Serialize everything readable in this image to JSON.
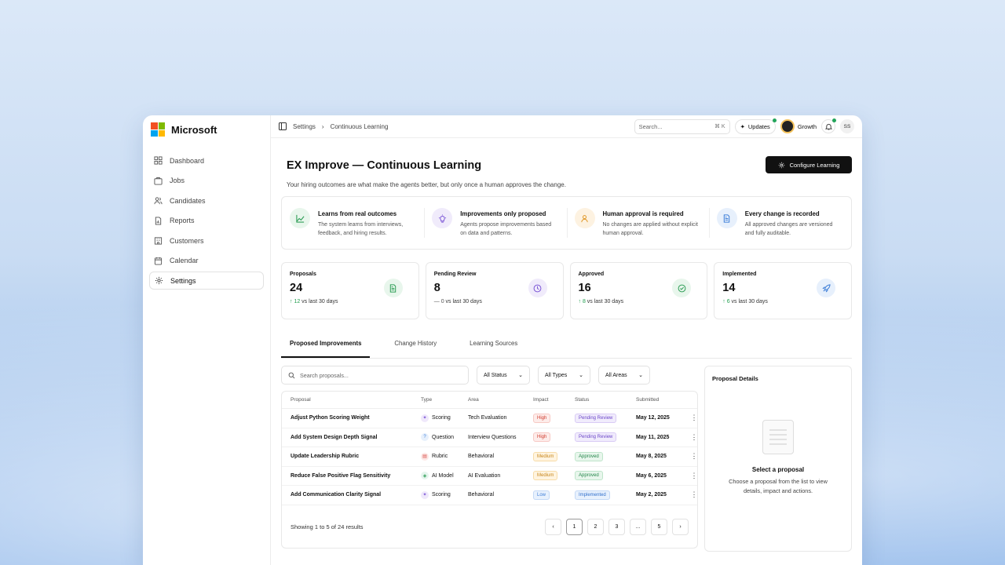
{
  "brand": {
    "name": "Microsoft",
    "logo_colors": [
      "#f25022",
      "#7fba00",
      "#00a4ef",
      "#ffb900"
    ]
  },
  "sidebar": {
    "items": [
      {
        "label": "Dashboard",
        "icon": "grid-icon"
      },
      {
        "label": "Jobs",
        "icon": "briefcase-icon"
      },
      {
        "label": "Candidates",
        "icon": "users-icon"
      },
      {
        "label": "Reports",
        "icon": "file-chart-icon"
      },
      {
        "label": "Customers",
        "icon": "building-icon"
      },
      {
        "label": "Calendar",
        "icon": "calendar-icon"
      },
      {
        "label": "Settings",
        "icon": "gear-icon",
        "active": true
      }
    ]
  },
  "topbar": {
    "breadcrumb": [
      "Settings",
      "Continuous Learning"
    ],
    "search_placeholder": "Search...",
    "search_shortcut": "⌘ K",
    "updates_label": "Updates",
    "workspace": "Growth",
    "user_initials": "SS"
  },
  "page": {
    "title": "EX Improve — Continuous Learning",
    "subtitle": "Your hiring outcomes are what make the agents better, but only once a human approves the change.",
    "configure_label": "Configure Learning"
  },
  "principles": [
    {
      "title": "Learns from real outcomes",
      "desc": "The system learns from interviews, feedback, and hiring results.",
      "icon": "trend-icon",
      "color": "#e8f6ec",
      "stroke": "#2f9e57"
    },
    {
      "title": "Improvements only proposed",
      "desc": "Agents propose improvements based on data and patterns.",
      "icon": "lightbulb-icon",
      "color": "#f0ebfb",
      "stroke": "#7c57d6"
    },
    {
      "title": "Human approval is required",
      "desc": "No changes are applied without explicit human approval.",
      "icon": "person-icon",
      "color": "#fdf2e1",
      "stroke": "#e19a2c"
    },
    {
      "title": "Every change is recorded",
      "desc": "All approved changes are versioned and fully auditable.",
      "icon": "document-icon",
      "color": "#e7f0fc",
      "stroke": "#3f7fd8"
    }
  ],
  "stats": [
    {
      "label": "Proposals",
      "value": "24",
      "arrow": "↑",
      "delta": "12",
      "suffix": "vs last 30 days",
      "icon": "document-icon",
      "bg": "#e8f6ec",
      "fg": "#2f9e57"
    },
    {
      "label": "Pending Review",
      "value": "8",
      "arrow": "—",
      "delta": "0",
      "suffix": "vs last 30 days",
      "icon": "clock-icon",
      "bg": "#f0ebfb",
      "fg": "#7c57d6"
    },
    {
      "label": "Approved",
      "value": "16",
      "arrow": "↑",
      "delta": "8",
      "suffix": "vs last 30 days",
      "icon": "check-circle-icon",
      "bg": "#e8f6ec",
      "fg": "#2f9e57"
    },
    {
      "label": "Implemented",
      "value": "14",
      "arrow": "↑",
      "delta": "6",
      "suffix": "vs last 30 days",
      "icon": "rocket-icon",
      "bg": "#e7f0fc",
      "fg": "#3f7fd8"
    }
  ],
  "tabs": [
    "Proposed Improvements",
    "Change History",
    "Learning Sources"
  ],
  "filters": {
    "search_placeholder": "Search proposals...",
    "status": "All Status",
    "types": "All Types",
    "areas": "All Areas"
  },
  "table": {
    "headers": [
      "Proposal",
      "Type",
      "Area",
      "Impact",
      "Status",
      "Submitted"
    ],
    "rows": [
      {
        "proposal": "Adjust Python Scoring Weight",
        "type": "Scoring",
        "area": "Tech Evaluation",
        "impact": "High",
        "status": "Pending Review",
        "submitted": "May 12, 2025"
      },
      {
        "proposal": "Add System Design Depth Signal",
        "type": "Question",
        "area": "Interview Questions",
        "impact": "High",
        "status": "Pending Review",
        "submitted": "May 11, 2025"
      },
      {
        "proposal": "Update Leadership Rubric",
        "type": "Rubric",
        "area": "Behavioral",
        "impact": "Medium",
        "status": "Approved",
        "submitted": "May 8, 2025"
      },
      {
        "proposal": "Reduce False Positive Flag Sensitivity",
        "type": "AI Model",
        "area": "AI Evaluation",
        "impact": "Medium",
        "status": "Approved",
        "submitted": "May 6, 2025"
      },
      {
        "proposal": "Add Communication Clarity Signal",
        "type": "Scoring",
        "area": "Behavioral",
        "impact": "Low",
        "status": "Implemented",
        "submitted": "May 2, 2025"
      }
    ],
    "showing": "Showing 1 to 5 of 24 results",
    "pages": [
      "1",
      "2",
      "3",
      "...",
      "5"
    ]
  },
  "details": {
    "title": "Proposal Details",
    "empty_title": "Select a proposal",
    "empty_desc": "Choose a proposal from the list to view details, impact and actions."
  }
}
